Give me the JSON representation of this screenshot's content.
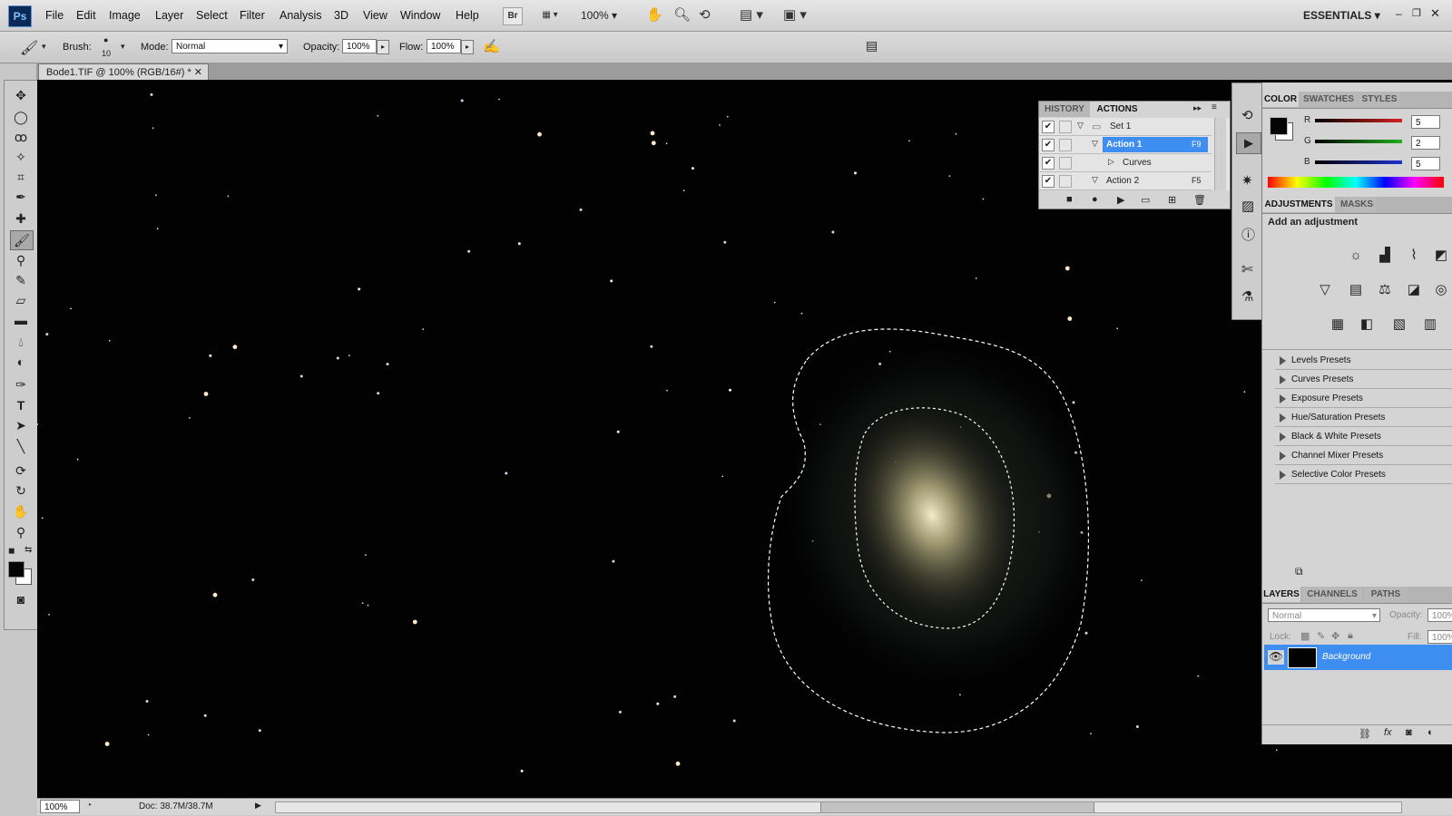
{
  "app": {
    "logo": "Ps"
  },
  "menu": [
    "File",
    "Edit",
    "Image",
    "Layer",
    "Select",
    "Filter",
    "Analysis",
    "3D",
    "View",
    "Window",
    "Help"
  ],
  "appbar": {
    "bridge": "Br",
    "zoom": "100%",
    "workspace": "ESSENTIALS",
    "icons": [
      "minimize-icon",
      "restore-icon",
      "close-icon"
    ]
  },
  "options": {
    "brush_label": "Brush:",
    "brush_size": "10",
    "mode_label": "Mode:",
    "mode_value": "Normal",
    "opacity_label": "Opacity:",
    "opacity_value": "100%",
    "flow_label": "Flow:",
    "flow_value": "100%"
  },
  "document": {
    "tab_title": "Bode1.TIF @ 100% (RGB/16#) *"
  },
  "status": {
    "zoom": "100%",
    "doc_info": "Doc: 38.7M/38.7M"
  },
  "actions_panel": {
    "tabs": [
      "HISTORY",
      "ACTIONS"
    ],
    "rows": [
      {
        "name": "Set 1",
        "shortcut": ""
      },
      {
        "name": "Action 1",
        "shortcut": "F9"
      },
      {
        "name": "Curves",
        "shortcut": ""
      },
      {
        "name": "Action 2",
        "shortcut": "F5"
      }
    ]
  },
  "color_panel": {
    "tabs": [
      "COLOR",
      "SWATCHES",
      "STYLES"
    ],
    "channels": [
      {
        "label": "R",
        "value": "5",
        "color": "#d62020"
      },
      {
        "label": "G",
        "value": "2",
        "color": "#20b020"
      },
      {
        "label": "B",
        "value": "5",
        "color": "#2030d0"
      }
    ]
  },
  "adjustments_panel": {
    "tabs": [
      "ADJUSTMENTS",
      "MASKS"
    ],
    "heading": "Add an adjustment",
    "presets": [
      "Levels Presets",
      "Curves Presets",
      "Exposure Presets",
      "Hue/Saturation Presets",
      "Black & White Presets",
      "Channel Mixer Presets",
      "Selective Color Presets"
    ]
  },
  "layers_panel": {
    "tabs": [
      "LAYERS",
      "CHANNELS",
      "PATHS"
    ],
    "blend_mode": "Normal",
    "opacity_label": "Opacity:",
    "opacity_value": "100%",
    "lock_label": "Lock:",
    "fill_label": "Fill:",
    "fill_value": "100%",
    "layers": [
      {
        "name": "Background"
      }
    ]
  },
  "colors": {
    "selection_blue": "#3d8ef0",
    "panel_bg": "#d4d4d4",
    "canvas_bg": "#020203"
  }
}
